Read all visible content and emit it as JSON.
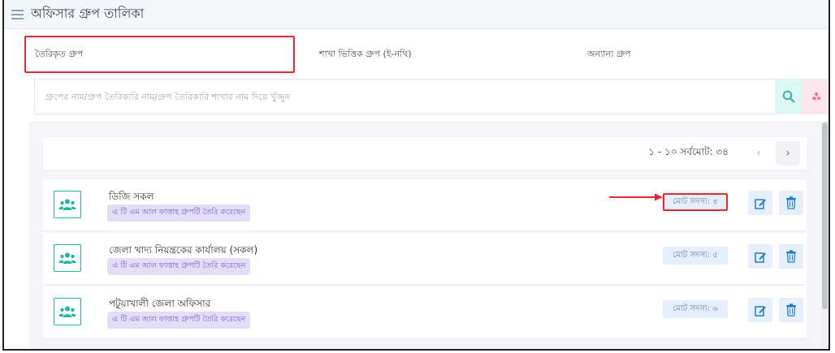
{
  "header": {
    "title": "অফিসার গ্রুপ তালিকা"
  },
  "tabs": [
    {
      "label": "তৈরিকৃত গ্রুপ",
      "active": true
    },
    {
      "label": "শাখা ভিত্তিক গ্রুপ (ই-নথি)",
      "active": false
    },
    {
      "label": "অন্যান্য গ্রুপ",
      "active": false
    }
  ],
  "search": {
    "placeholder": "গ্রুপের নাম/গ্রুপ তৈরিকারি নাম/গ্রুপ তৈরিকারি শাখার নাম দিয়ে খুঁজুন",
    "value": ""
  },
  "pager": {
    "range": "১ - ১০ সর্বমোট: ৩৪",
    "prev": "‹",
    "next": "›"
  },
  "rows": [
    {
      "name": "ডিজি সকল",
      "creator": "এ টি এম আল ফাত্তাহ গ্রুপটি তৈরি করেছেন",
      "members": "মোট সদস্য: ৪",
      "highlighted": true
    },
    {
      "name": "জেলা খাদ্য নিয়ন্ত্রকের কার্যালয় (সকল)",
      "creator": "এ টি এম আল ফাত্তাহ গ্রুপটি তৈরি করেছেন",
      "members": "মোট সদস্য: ৫",
      "highlighted": false
    },
    {
      "name": "পটুয়াখালী জেলা অফিসার",
      "creator": "এ টি এম আল ফাত্তাহ গ্রুপটি তৈরি করেছেন",
      "members": "মোট সদস্য: ৬",
      "highlighted": false
    }
  ],
  "icons": {
    "list": "list-icon",
    "search": "search-icon",
    "reset": "recycle-icon",
    "group": "users-icon",
    "edit": "edit-icon",
    "delete": "trash-icon"
  },
  "colors": {
    "accent": "#1eb7a6",
    "highlight": "#e8262d",
    "badge_bg": "#e4ddf7",
    "badge_text": "#7a63c8",
    "members_bg": "#e5eefb",
    "edit_icon": "#1f7fd1"
  }
}
